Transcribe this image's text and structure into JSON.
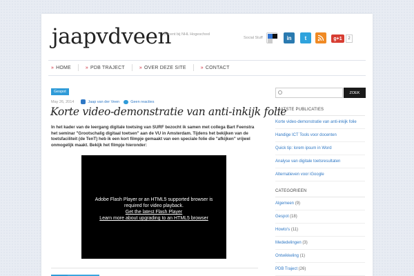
{
  "site": {
    "logo": "jaapvdveen",
    "tagline": "Docent bij NHL Hogeschool",
    "social_label": "Social Stuff",
    "gplus_label": "g+1",
    "gplus_count": "2"
  },
  "nav": [
    {
      "label": "Home"
    },
    {
      "label": "PDB Traject"
    },
    {
      "label": "Over deze site"
    },
    {
      "label": "Contact"
    }
  ],
  "post": {
    "category": "Gespot",
    "date": "May 26, 2014",
    "author": "Jaap van der Veen",
    "comments": "Geen reacties",
    "title": "Korte video-demonstratie van anti-inkijk folie",
    "body": "In het kader van de leergang digitale toetsing van SURF bezocht ik samen met collega Bart Feenstra het seminar \"Grootschalig digitaal toetsen\" aan de VU in Amsterdam. Tijdens het bekijken van de toetsfaciliteit (de TenT) heb ik een kort filmpje gemaakt van een speciale folie die \"afkijken\" vrijwel onmogelijk maakt. Bekijk het filmpje hieronder:",
    "video": {
      "message": "Adobe Flash Player or an HTML5 supported browser is required for video playback.",
      "link1": "Get the latest Flash Player",
      "link2": "Learn more about upgrading to an HTML5 browser"
    }
  },
  "sidebar": {
    "search_placeholder": "",
    "search_button": "ZOEK",
    "recent_title": "LAATSTE PUBLICATIES",
    "recent": [
      {
        "label": "Korte video-demonstratie van anti-inkijk folie"
      },
      {
        "label": "Handige ICT Tools voor docenten"
      },
      {
        "label": "Quick tip: lorem ipsum in Word"
      },
      {
        "label": "Analyse van digitale toetsresultaten"
      },
      {
        "label": "Alternatieven voor iGoogle"
      }
    ],
    "categories_title": "CATEGORIEEN",
    "categories": [
      {
        "label": "Algemeen",
        "count": " (9)"
      },
      {
        "label": "Gespot",
        "count": " (18)"
      },
      {
        "label": "Howto's",
        "count": " (11)"
      },
      {
        "label": "Mededelingen",
        "count": " (3)"
      },
      {
        "label": "Ontwikkeling",
        "count": " (1)"
      },
      {
        "label": "PDB Traject",
        "count": " (26)"
      }
    ]
  },
  "colors": {
    "accent_blue": "#2f9bd8",
    "link_blue": "#2f78c5",
    "nav_chevron": "#cc2233"
  }
}
